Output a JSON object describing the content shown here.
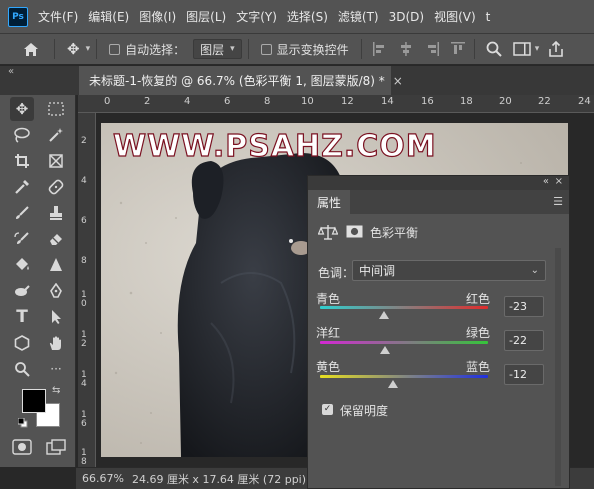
{
  "app": {
    "logo": "Ps"
  },
  "menu": [
    "文件(F)",
    "编辑(E)",
    "图像(I)",
    "图层(L)",
    "文字(Y)",
    "选择(S)",
    "滤镜(T)",
    "3D(D)",
    "视图(V)",
    "t"
  ],
  "options": {
    "auto_select_label": "自动选择：",
    "auto_select_value": "图层",
    "show_transform_label": "显示变换控件"
  },
  "document": {
    "tab_title": "未标题-1-恢复的 @ 66.7% (色彩平衡 1, 图层蒙版/8) *",
    "close": "×",
    "watermark": "WWW.PSAHZ.COM"
  },
  "ruler": {
    "top": [
      "0",
      "2",
      "4",
      "6",
      "8",
      "10",
      "12",
      "14",
      "16",
      "18",
      "20",
      "22",
      "24"
    ],
    "left": [
      "2",
      "4",
      "6",
      "8",
      "1 0",
      "1 2",
      "1 4",
      "1 6",
      "1 8"
    ]
  },
  "status": {
    "zoom": "66.67%",
    "doc_size": "24.69 厘米 x 17.64 厘米 (72 ppi)"
  },
  "properties": {
    "tab": "属性",
    "adjustment_title": "色彩平衡",
    "tone_label": "色调：",
    "tone_value": "中间调",
    "sliders": [
      {
        "left": "青色",
        "right": "红色",
        "value": "-23",
        "position": -23,
        "gradient": [
          "#2fd0d0",
          "#e02c2c"
        ]
      },
      {
        "left": "洋红",
        "right": "绿色",
        "value": "-22",
        "position": -22,
        "gradient": [
          "#d428d4",
          "#35c53a"
        ]
      },
      {
        "left": "黄色",
        "right": "蓝色",
        "value": "-12",
        "position": -12,
        "gradient": [
          "#e8e020",
          "#2030e0"
        ]
      }
    ],
    "preserve_luminosity": "保留明度"
  },
  "colors": {
    "foreground": "#000000",
    "background": "#ffffff",
    "accent": "#31a8ff"
  }
}
